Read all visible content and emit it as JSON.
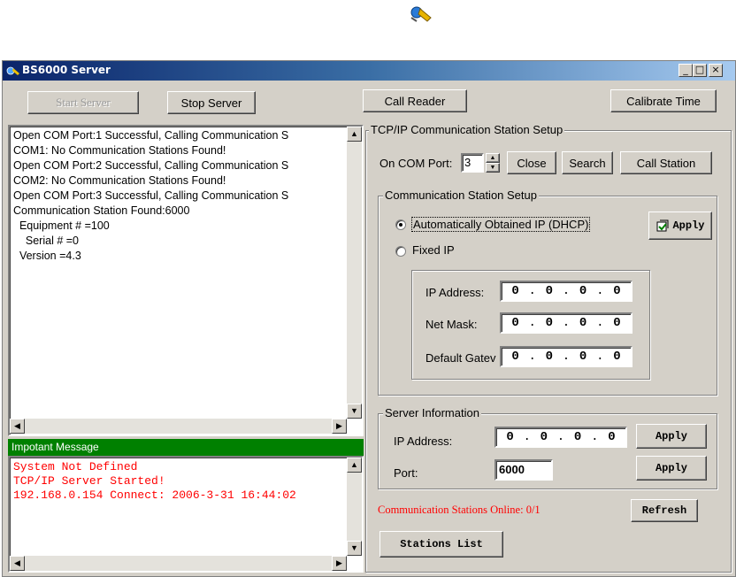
{
  "desktop": {
    "icon": "network-app-icon"
  },
  "window": {
    "title": "BS6000 Server",
    "controls": {
      "minimize": "_",
      "maximize": "□",
      "close": "×"
    }
  },
  "toolbar": {
    "start_server": "Start Server",
    "stop_server": "Stop Server",
    "call_reader": "Call Reader",
    "calibrate_time": "Calibrate Time"
  },
  "log": {
    "lines": [
      "Open COM Port:1 Successful, Calling Communication S",
      "COM1: No Communication Stations Found!",
      "Open COM Port:2 Successful, Calling Communication S",
      "COM2: No Communication Stations Found!",
      "Open COM Port:3 Successful, Calling Communication S",
      "Communication Station Found:6000",
      "  Equipment # =100",
      "    Serial # =0",
      "  Version =4.3"
    ]
  },
  "important": {
    "header": "Impotant Message",
    "lines": [
      "System Not Defined",
      "TCP/IP Server Started!",
      "192.168.0.154 Connect: 2006-3-31 16:44:02"
    ]
  },
  "tcpip": {
    "group_label": "TCP/IP Communication Station Setup",
    "com_port_label": "On COM Port:",
    "com_port_value": "3",
    "close_button": "Close",
    "search_button": "Search",
    "call_station_button": "Call Station",
    "station_setup": {
      "group_label": "Communication Station Setup",
      "dhcp_label": "Automatically Obtained IP (DHCP)",
      "fixed_label": "Fixed IP",
      "apply_button": "Apply",
      "ip_label": "IP Address:",
      "mask_label": "Net Mask:",
      "gateway_label": "Default Gatev",
      "ip_value": [
        "0",
        "0",
        "0",
        "0"
      ],
      "mask_value": [
        "0",
        "0",
        "0",
        "0"
      ],
      "gateway_value": [
        "0",
        "0",
        "0",
        "0"
      ]
    }
  },
  "server_info": {
    "group_label": "Server Information",
    "ip_label": "IP Address:",
    "ip_value": [
      "0",
      "0",
      "0",
      "0"
    ],
    "port_label": "Port:",
    "port_value": "6000",
    "apply_ip_button": "Apply",
    "apply_port_button": "Apply"
  },
  "status": {
    "online_text": "Communication Stations Online: 0/1",
    "online_color": "#ff0000",
    "refresh_button": "Refresh",
    "stations_list_button": "Stations List"
  }
}
